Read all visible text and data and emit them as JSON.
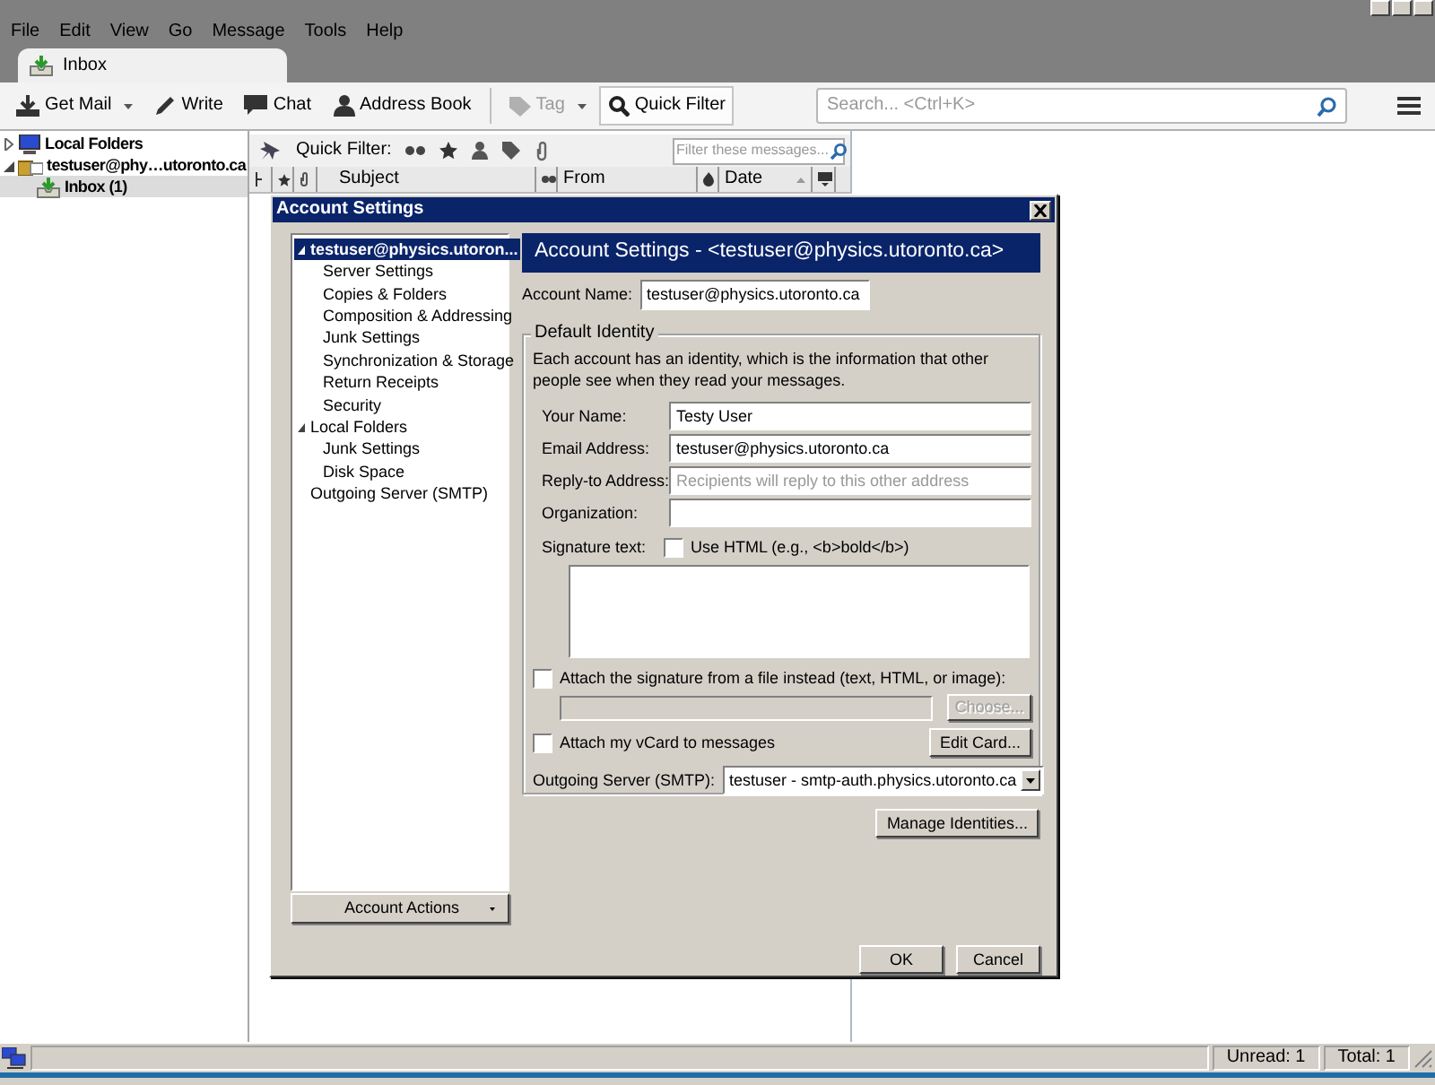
{
  "menu": [
    "File",
    "Edit",
    "View",
    "Go",
    "Message",
    "Tools",
    "Help"
  ],
  "tabs": [
    {
      "label": "Inbox",
      "selected": true
    }
  ],
  "toolbar": {
    "buttons": [
      {
        "kind": "get-mail",
        "label": "Get Mail",
        "dropdown": true,
        "disabled": false,
        "pressed": false
      },
      {
        "kind": "write",
        "label": "Write",
        "dropdown": false,
        "disabled": false,
        "pressed": false
      },
      {
        "kind": "chat",
        "label": "Chat",
        "dropdown": false,
        "disabled": false,
        "pressed": false
      },
      {
        "kind": "address-book",
        "label": "Address Book",
        "dropdown": false,
        "disabled": false,
        "pressed": false
      },
      {
        "kind": "tag",
        "label": "Tag",
        "dropdown": true,
        "disabled": true,
        "pressed": false
      },
      {
        "kind": "quick-filter",
        "label": "Quick Filter",
        "dropdown": false,
        "disabled": false,
        "pressed": true
      }
    ],
    "search": {
      "placeholder": "Search... <Ctrl+K>"
    }
  },
  "folders": [
    {
      "kind": "local",
      "label": "Local Folders",
      "expanded": false,
      "selected": false
    },
    {
      "kind": "account",
      "label": "testuser@phy…utoronto.ca",
      "expanded": true,
      "selected": false,
      "children": [
        {
          "kind": "inbox",
          "label": "Inbox (1)",
          "selected": true
        }
      ]
    }
  ],
  "quick_filter": {
    "label": "Quick Filter:",
    "placeholder": "Filter these messages..."
  },
  "columns": [
    "Subject",
    "From",
    "Date"
  ],
  "dialog": {
    "title": "Account Settings",
    "tree": [
      {
        "label": "testuser@physics.utoron...",
        "selected": true,
        "expanded": true,
        "children": [
          {
            "label": "Server Settings",
            "selected": false
          },
          {
            "label": "Copies & Folders",
            "selected": false
          },
          {
            "label": "Composition & Addressing",
            "selected": false
          },
          {
            "label": "Junk Settings",
            "selected": false
          },
          {
            "label": "Synchronization & Storage",
            "selected": false
          },
          {
            "label": "Return Receipts",
            "selected": false
          },
          {
            "label": "Security",
            "selected": false
          }
        ]
      },
      {
        "label": "Local Folders",
        "selected": false,
        "expanded": true,
        "children": [
          {
            "label": "Junk Settings",
            "selected": false
          },
          {
            "label": "Disk Space",
            "selected": false
          }
        ]
      },
      {
        "label": "Outgoing Server (SMTP)",
        "selected": false
      }
    ],
    "account_actions": "Account Actions",
    "header": "Account Settings - <testuser@physics.utoronto.ca>",
    "account_name": {
      "label": "Account Name:",
      "value": "testuser@physics.utoronto.ca"
    },
    "identity": {
      "legend": "Default Identity",
      "description": "Each account has an identity, which is the information that other people see when they read your messages.",
      "fields": [
        {
          "label": "Your Name:",
          "value": "Testy User"
        },
        {
          "label": "Email Address:",
          "value": "testuser@physics.utoronto.ca"
        },
        {
          "label": "Reply-to Address:",
          "placeholder": "Recipients will reply to this other address"
        },
        {
          "label": "Organization:"
        }
      ],
      "signature_label": "Signature text:",
      "use_html": {
        "label": "Use HTML (e.g., <b>bold</b>)",
        "checked": false
      },
      "attach_file": {
        "label": "Attach the signature from a file instead (text, HTML, or image):",
        "checked": false
      },
      "file_field": {
        "disabled": true
      },
      "choose": {
        "label": "Choose...",
        "disabled": true
      },
      "vcard": {
        "label": "Attach my vCard to messages",
        "checked": false
      },
      "edit_card": "Edit Card...",
      "smtp": {
        "label": "Outgoing Server (SMTP):",
        "value": "testuser - smtp-auth.physics.utoronto.ca"
      }
    },
    "manage": "Manage Identities...",
    "buttons": [
      "OK",
      "Cancel"
    ]
  },
  "status_bar": {
    "unread": "Unread: 1",
    "total": "Total: 1"
  }
}
